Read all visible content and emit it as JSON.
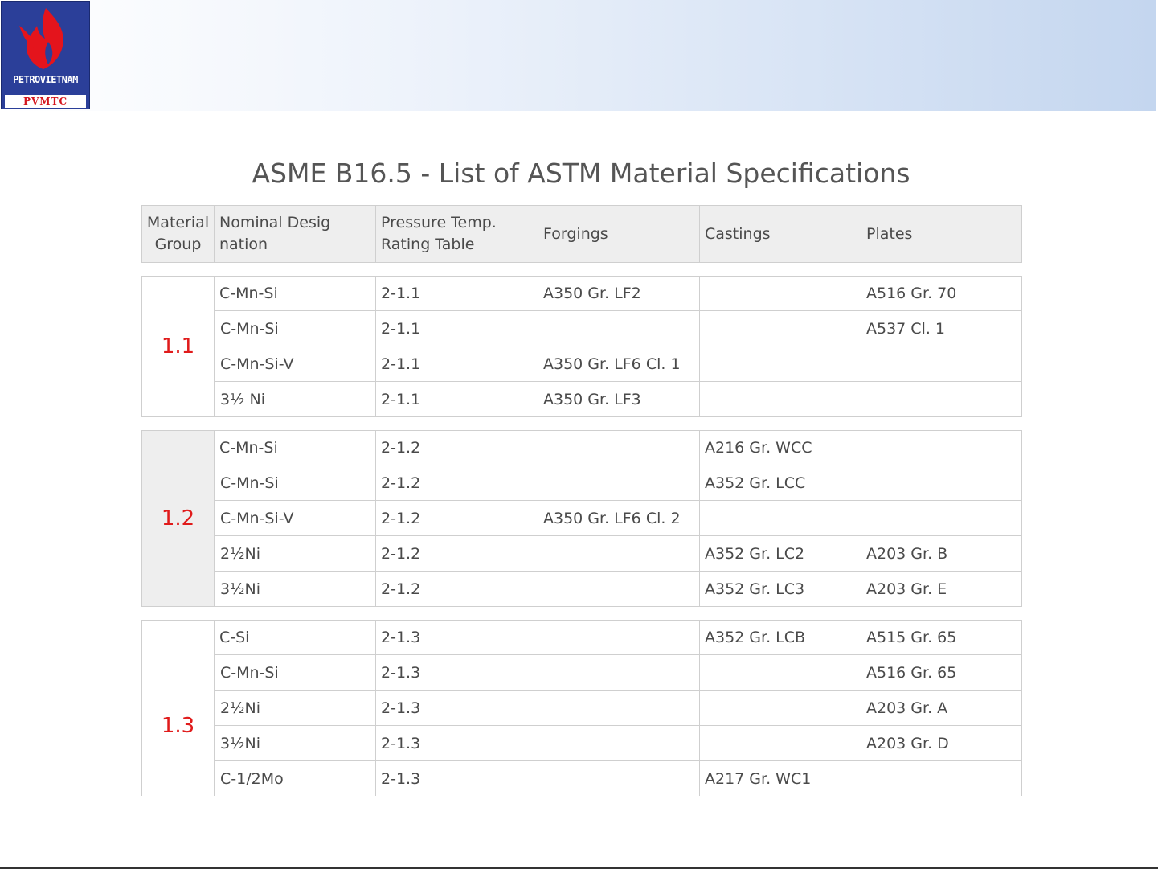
{
  "header": {
    "logo_text": "PETROVIETNAM",
    "logo_sub": "PVMTC"
  },
  "title": "ASME B16.5 - List of ASTM Material Specifications",
  "colors": {
    "group_label": "#e01b1b",
    "header_bg": "#eeeeee",
    "border": "#cfcfcf"
  },
  "table": {
    "headers": {
      "group_l1": "Material",
      "group_l2": "Group",
      "nominal_l1": "Nominal Desig",
      "nominal_l2": "nation",
      "rating_l1": "Pressure Temp.",
      "rating_l2": "Rating Table",
      "forgings": "Forgings",
      "castings": "Castings",
      "plates": "Plates"
    },
    "groups": [
      {
        "label": "1.1",
        "rows": [
          {
            "nominal": "C-Mn-Si",
            "rating": "2-1.1",
            "forgings": "A350 Gr. LF2",
            "castings": "",
            "plates": "A516 Gr. 70"
          },
          {
            "nominal": "C-Mn-Si",
            "rating": "2-1.1",
            "forgings": "",
            "castings": "",
            "plates": "A537 Cl. 1"
          },
          {
            "nominal": "C-Mn-Si-V",
            "rating": "2-1.1",
            "forgings": "A350 Gr. LF6 Cl. 1",
            "castings": "",
            "plates": ""
          },
          {
            "nominal": "3½ Ni",
            "rating": "2-1.1",
            "forgings": "A350 Gr. LF3",
            "castings": "",
            "plates": ""
          }
        ]
      },
      {
        "label": "1.2",
        "rows": [
          {
            "nominal": "C-Mn-Si",
            "rating": "2-1.2",
            "forgings": "",
            "castings": "A216 Gr. WCC",
            "plates": ""
          },
          {
            "nominal": "C-Mn-Si",
            "rating": "2-1.2",
            "forgings": "",
            "castings": "A352 Gr. LCC",
            "plates": ""
          },
          {
            "nominal": "C-Mn-Si-V",
            "rating": "2-1.2",
            "forgings": "A350 Gr. LF6 Cl. 2",
            "castings": "",
            "plates": ""
          },
          {
            "nominal": "2½Ni",
            "rating": "2-1.2",
            "forgings": "",
            "castings": "A352 Gr. LC2",
            "plates": "A203 Gr. B"
          },
          {
            "nominal": "3½Ni",
            "rating": "2-1.2",
            "forgings": "",
            "castings": "A352 Gr. LC3",
            "plates": "A203 Gr. E"
          }
        ]
      },
      {
        "label": "1.3",
        "rows": [
          {
            "nominal": "C-Si",
            "rating": "2-1.3",
            "forgings": "",
            "castings": "A352 Gr. LCB",
            "plates": "A515 Gr. 65"
          },
          {
            "nominal": "C-Mn-Si",
            "rating": "2-1.3",
            "forgings": "",
            "castings": "",
            "plates": "A516 Gr. 65"
          },
          {
            "nominal": "2½Ni",
            "rating": "2-1.3",
            "forgings": "",
            "castings": "",
            "plates": "A203 Gr. A"
          },
          {
            "nominal": "3½Ni",
            "rating": "2-1.3",
            "forgings": "",
            "castings": "",
            "plates": "A203 Gr. D"
          },
          {
            "nominal": "C-1/2Mo",
            "rating": "2-1.3",
            "forgings": "",
            "castings": "A217 Gr. WC1",
            "plates": ""
          },
          {
            "nominal": "",
            "rating": "",
            "forgings": "",
            "castings": "",
            "plates": ""
          }
        ]
      }
    ]
  }
}
